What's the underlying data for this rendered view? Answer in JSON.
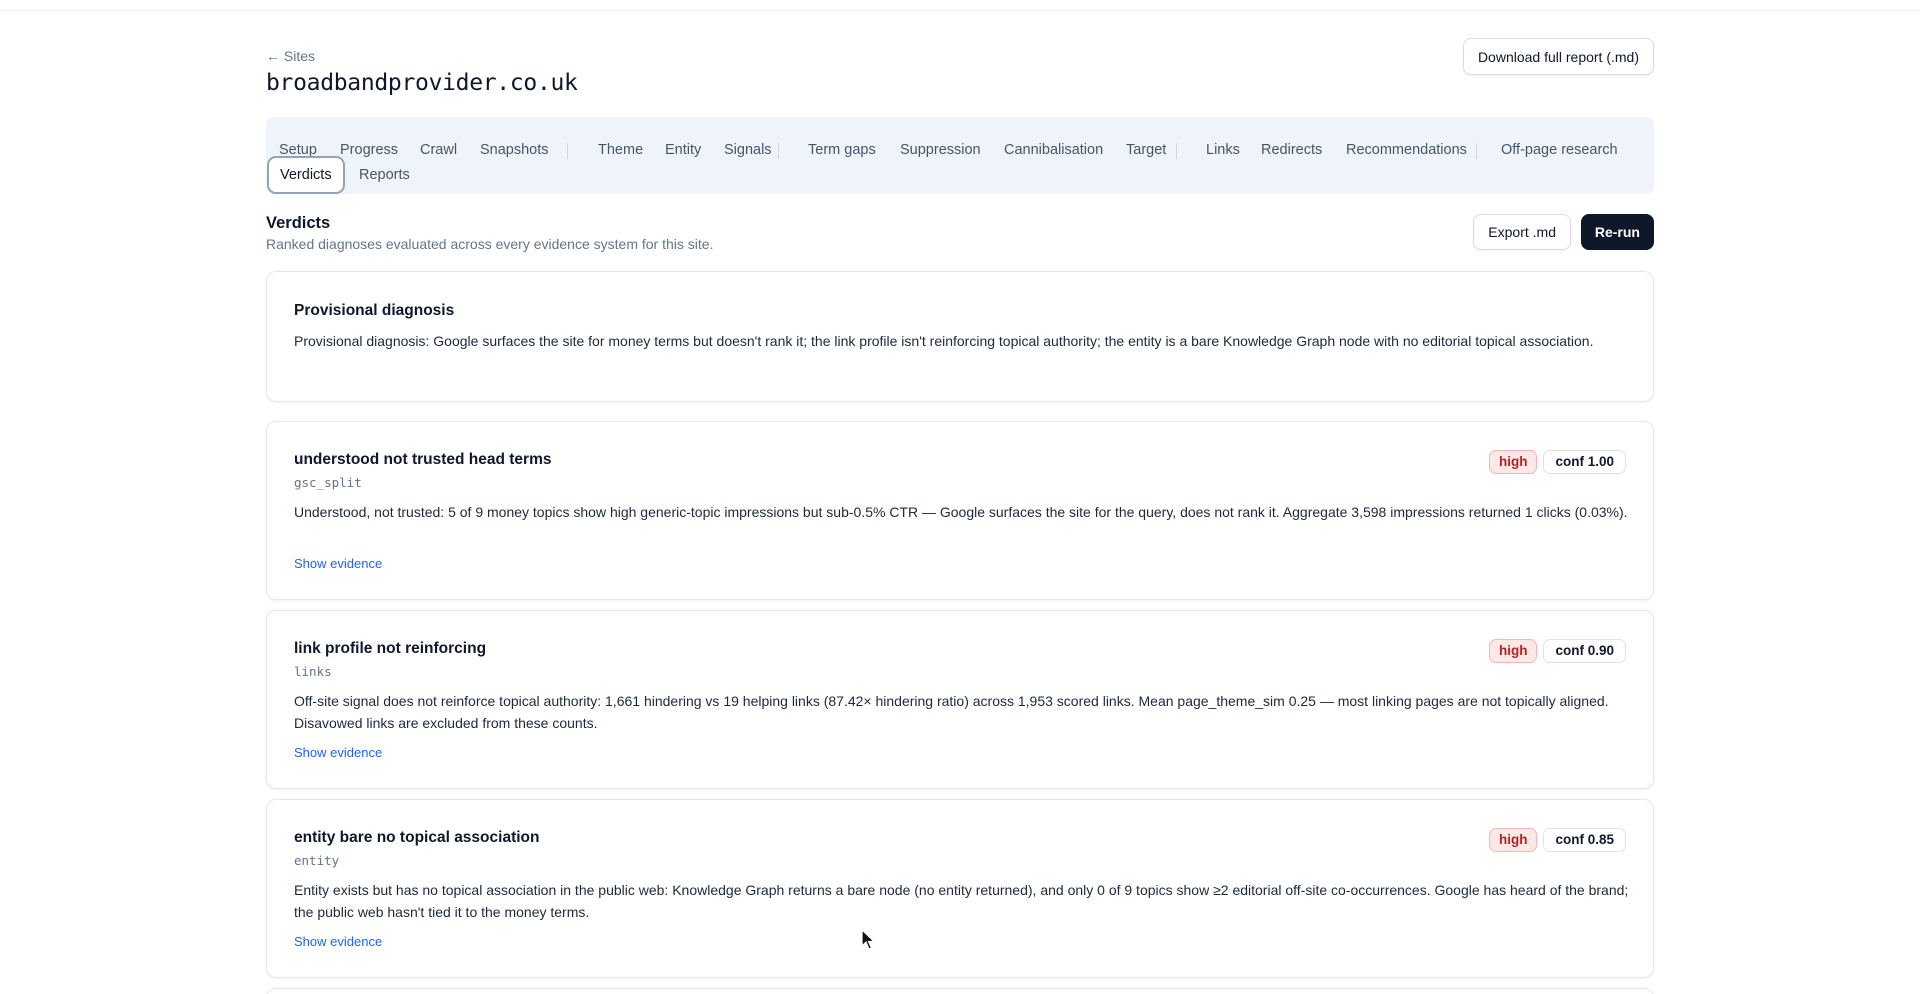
{
  "header": {
    "back_label": "← Sites",
    "site": "broadbandprovider.co.uk",
    "download_label": "Download full report (.md)"
  },
  "tabs": [
    {
      "label": "Setup"
    },
    {
      "label": "Progress"
    },
    {
      "label": "Crawl"
    },
    {
      "label": "Snapshots"
    },
    {
      "label": "Theme"
    },
    {
      "label": "Entity"
    },
    {
      "label": "Signals"
    },
    {
      "label": "Term gaps"
    },
    {
      "label": "Suppression"
    },
    {
      "label": "Cannibalisation"
    },
    {
      "label": "Target"
    },
    {
      "label": "Links"
    },
    {
      "label": "Redirects"
    },
    {
      "label": "Recommendations"
    },
    {
      "label": "Off-page research"
    },
    {
      "label": "Verdicts",
      "active": true
    },
    {
      "label": "Reports"
    }
  ],
  "section": {
    "title": "Verdicts",
    "subtitle": "Ranked diagnoses evaluated across every evidence system for this site.",
    "export_label": "Export .md",
    "rerun_label": "Re-run"
  },
  "provisional": {
    "title": "Provisional diagnosis",
    "body": "Provisional diagnosis: Google surfaces the site for money terms but doesn't rank it; the link profile isn't reinforcing topical authority; the entity is a bare Knowledge Graph node with no editorial topical association."
  },
  "verdicts": [
    {
      "title": "understood not trusted head terms",
      "source": "gsc_split",
      "severity": "high",
      "confidence": "conf 1.00",
      "body": "Understood, not trusted: 5 of 9 money topics show high generic-topic impressions but sub-0.5% CTR — Google surfaces the site for the query, does not rank it. Aggregate 3,598 impressions returned 1 clicks (0.03%).",
      "evidence_label": "Show evidence"
    },
    {
      "title": "link profile not reinforcing",
      "source": "links",
      "severity": "high",
      "confidence": "conf 0.90",
      "body": "Off-site signal does not reinforce topical authority: 1,661 hindering vs 19 helping links (87.42× hindering ratio) across 1,953 scored links. Mean page_theme_sim 0.25 — most linking pages are not topically aligned. Disavowed links are excluded from these counts.",
      "evidence_label": "Show evidence"
    },
    {
      "title": "entity bare no topical association",
      "source": "entity",
      "severity": "high",
      "confidence": "conf 0.85",
      "body": "Entity exists but has no topical association in the public web: Knowledge Graph returns a bare node (no entity returned), and only 0 of 9 topics show ≥2 editorial off-site co-occurrences. Google has heard of the brand; the public web hasn't tied it to the money terms.",
      "evidence_label": "Show evidence"
    }
  ]
}
